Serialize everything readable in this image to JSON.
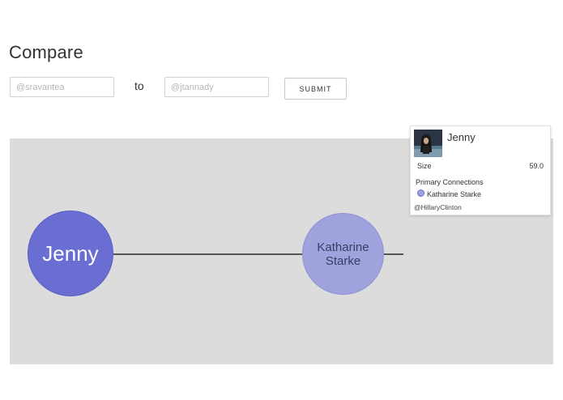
{
  "page": {
    "title": "Compare",
    "to_label": "to"
  },
  "form": {
    "input_a_placeholder": "@sravantea",
    "input_b_placeholder": "@jtannady",
    "submit_label": "SUBMIT"
  },
  "graph": {
    "nodes": [
      {
        "label": "Jenny",
        "color": "#6a6ed2"
      },
      {
        "label": "Katharine Starke",
        "color": "#9fa2dc"
      }
    ],
    "background": "#dcdcdc",
    "edge_color": "#555555"
  },
  "info_card": {
    "name": "Jenny",
    "size_label": "Size",
    "size_value": "59.0",
    "primary_connections_label": "Primary Connections",
    "connections": [
      "Katharine Starke"
    ],
    "handle": "@HillaryClinton",
    "avatar_icon": "profile-photo-icon"
  }
}
